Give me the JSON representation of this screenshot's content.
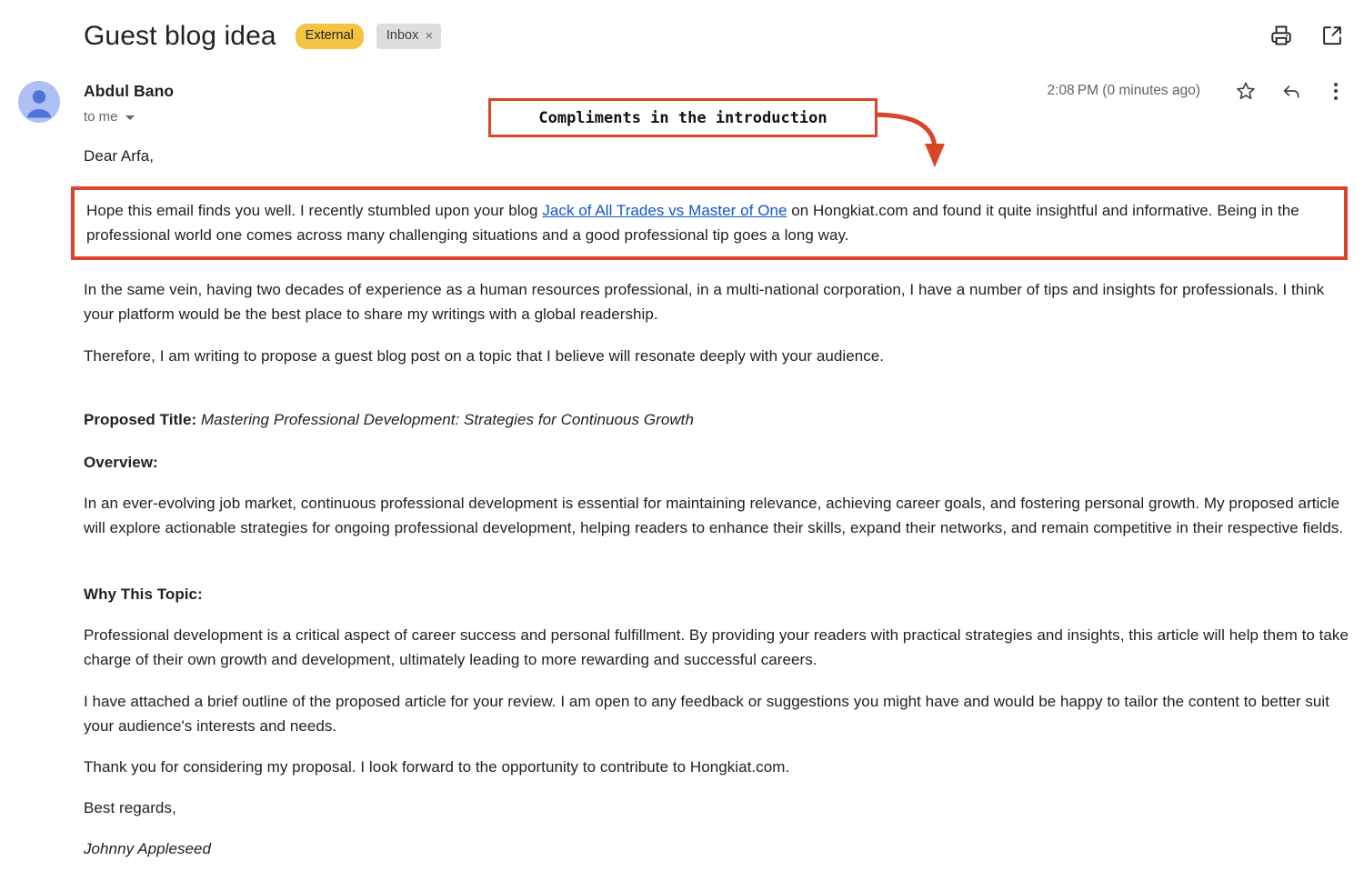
{
  "header": {
    "subject": "Guest blog idea",
    "badges": [
      {
        "name": "external",
        "label": "External"
      },
      {
        "name": "inbox",
        "label": "Inbox",
        "close": "×"
      }
    ],
    "actions": [
      {
        "name": "print-icon",
        "label": "Print"
      },
      {
        "name": "open-in-new-icon",
        "label": "Open in new window"
      }
    ]
  },
  "message": {
    "sender_name": "Abdul Bano",
    "recipient": "to me",
    "timestamp": "2:08 PM (0 minutes ago)",
    "actions": [
      {
        "name": "star-icon",
        "label": "Star"
      },
      {
        "name": "reply-icon",
        "label": "Reply"
      },
      {
        "name": "more-options-icon",
        "label": "More"
      }
    ],
    "avatar_alt": "Abdul Bano"
  },
  "body": {
    "greeting": "Dear Arfa,",
    "intro": {
      "before_link": "Hope this email finds you well. I recently stumbled upon your blog ",
      "link_text": "Jack of All Trades vs Master of One",
      "after_link": " on Hongkiat.com and found it quite insightful and informative. Being in the professional world one comes across many challenging situations and a good professional tip goes a long way."
    },
    "paragraph_2": "In the same vein, having two decades of experience as a human resources professional, in a multi-national corporation, I have a number of tips and insights for professionals. I think your platform would be the best place to share my writings with a global readership.",
    "paragraph_3": "Therefore, I am writing to propose a guest blog post on a topic that I believe will resonate deeply with your audience.",
    "proposed_title_label": "Proposed Title:",
    "proposed_title_value": "Mastering Professional Development: Strategies for Continuous Growth",
    "overview_heading": "Overview:",
    "overview_body": "In an ever-evolving job market, continuous professional development is essential for maintaining relevance, achieving career goals, and fostering personal growth. My proposed article will explore actionable strategies for ongoing professional development, helping readers to enhance their skills, expand their networks, and remain competitive in their respective fields.",
    "why_heading": "Why This Topic:",
    "why_body": "Professional development is a critical aspect of career success and personal fulfillment. By providing your readers with practical strategies and insights, this article will help them to take charge of their own growth and development, ultimately leading to more rewarding and successful careers.",
    "attachment_note": "I have attached a brief outline of the proposed article for your review. I am open to any feedback or suggestions you might have and would be happy to tailor the content to better suit your audience's interests and needs.",
    "closing_thanks": "Thank you for considering my proposal. I look forward to the opportunity to contribute to Hongkiat.com.",
    "sign_off": "Best regards,",
    "signature": "Johnny Appleseed"
  },
  "annotation": {
    "text": "Compliments in the introduction",
    "color": "#d94526"
  },
  "colors": {
    "link": "#1155cc",
    "badge_external_bg": "#f5c344",
    "badge_inbox_bg": "#dddddd",
    "annotation_red": "#d94526",
    "avatar_bg": "#aec1f5",
    "avatar_fg": "#4f74d8",
    "text": "#202124",
    "muted": "#5f6368"
  }
}
